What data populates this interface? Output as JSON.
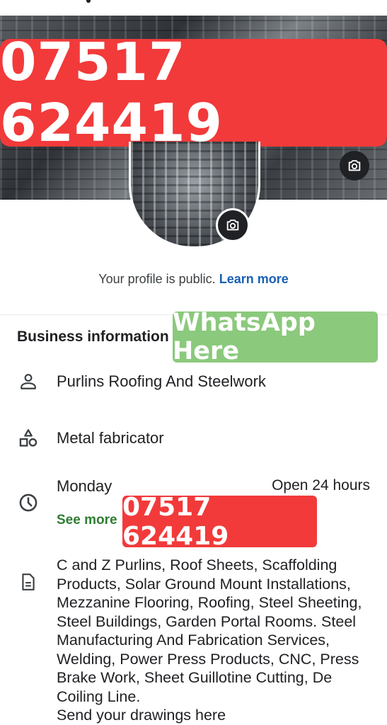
{
  "banner_top": {
    "phone": "07517 624419"
  },
  "profile": {
    "public_text": "Your profile is public.",
    "learn_more": "Learn more"
  },
  "business": {
    "section_title": "Business information",
    "whatsapp_label": "WhatsApp Here",
    "name": "Purlins Roofing And Steelwork",
    "category": "Metal fabricator",
    "hours_day": "Monday",
    "hours_value": "Open 24 hours",
    "see_more": "See more",
    "phone_overlay": "07517 624419",
    "description": "C and Z Purlins, Roof Sheets, Scaffolding Products, Solar Ground Mount Installations, Mezzanine Flooring, Roofing, Steel Sheeting, Steel Buildings, Garden Portal Rooms. Steel Manufacturing And Fabrication Services, Welding, Power Press Products, CNC, Press Brake Work, Sheet Guillotine Cutting, De Coiling Line.\nSend your drawings here"
  },
  "icons": {
    "cover_camera": "camera-icon",
    "avatar_camera": "camera-icon",
    "name_row": "person-icon",
    "category_row": "shapes-icon",
    "hours_row": "clock-icon",
    "description_row": "document-icon"
  },
  "colors": {
    "banner_red": "#f23a3a",
    "whatsapp_green": "#8bc97c",
    "link_blue": "#1a5fb4",
    "see_more_green": "#2e7d32"
  }
}
